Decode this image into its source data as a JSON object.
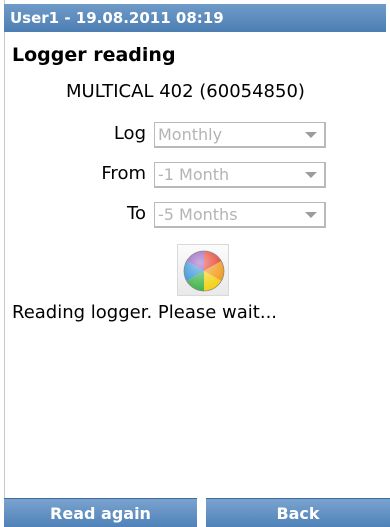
{
  "header": {
    "user_datetime": "User1 - 19.08.2011 08:19"
  },
  "page": {
    "title": "Logger reading",
    "device": "MULTICAL 402  (60054850)"
  },
  "form": {
    "log_label": "Log",
    "log_value": "Monthly",
    "from_label": "From",
    "from_value": "-1 Month",
    "to_label": "To",
    "to_value": "-5 Months"
  },
  "status": {
    "message": "Reading logger. Please wait..."
  },
  "buttons": {
    "read_again": "Read again",
    "back": "Back"
  },
  "colors": {
    "header_bar": "#5b8abd",
    "button": "#6292c4",
    "disabled_text": "#b4b4b4"
  },
  "icons": {
    "busy_indicator": "color-wheel-icon"
  }
}
